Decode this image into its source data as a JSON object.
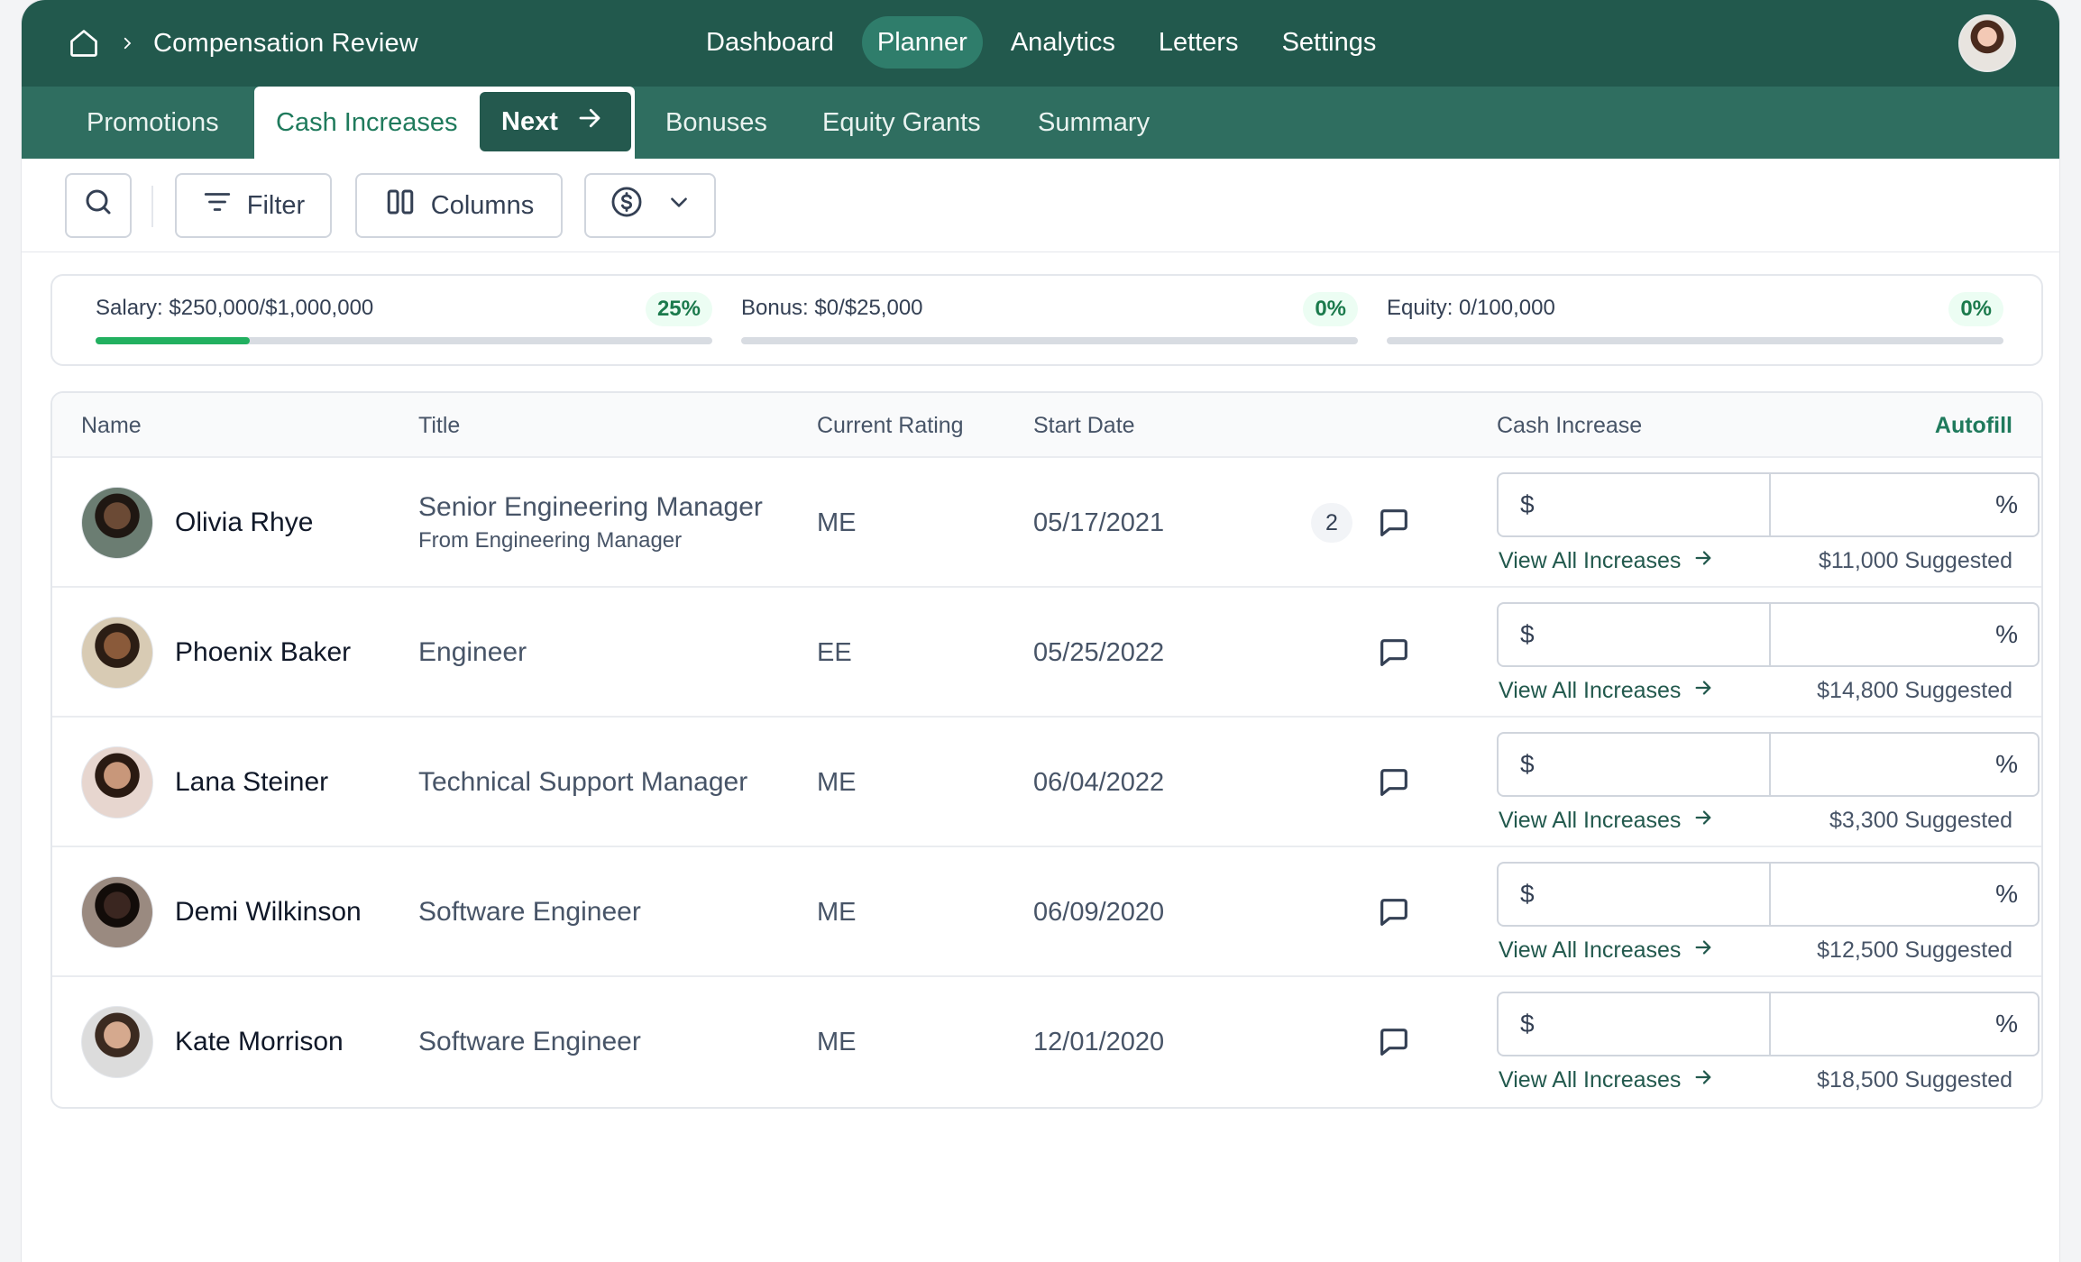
{
  "breadcrumb": {
    "title": "Compensation Review"
  },
  "nav": {
    "items": [
      {
        "label": "Dashboard",
        "active": false
      },
      {
        "label": "Planner",
        "active": true
      },
      {
        "label": "Analytics",
        "active": false
      },
      {
        "label": "Letters",
        "active": false
      },
      {
        "label": "Settings",
        "active": false
      }
    ]
  },
  "subtabs": {
    "promotions": "Promotions",
    "cash_increases": "Cash Increases",
    "next": "Next",
    "bonuses": "Bonuses",
    "equity": "Equity Grants",
    "summary": "Summary"
  },
  "toolbar": {
    "filter": "Filter",
    "columns": "Columns"
  },
  "budget": [
    {
      "label": "Salary:",
      "value": "$250,000/$1,000,000",
      "percent": "25%",
      "progress": 0.25
    },
    {
      "label": "Bonus:",
      "value": "$0/$25,000",
      "percent": "0%",
      "progress": 0
    },
    {
      "label": "Equity:",
      "value": "0/100,000",
      "percent": "0%",
      "progress": 0
    }
  ],
  "table": {
    "headers": {
      "name": "Name",
      "title": "Title",
      "rating": "Current Rating",
      "start": "Start Date",
      "cash": "Cash Increase",
      "autofill": "Autofill"
    },
    "dollar_symbol": "$",
    "percent_symbol": "%",
    "view_all": "View All Increases",
    "rows": [
      {
        "name": "Olivia Rhye",
        "title": "Senior Engineering Manager",
        "subtitle": "From Engineering Manager",
        "rating": "ME",
        "start": "05/17/2021",
        "comments": "2",
        "suggested": "$11,000 Suggested"
      },
      {
        "name": "Phoenix Baker",
        "title": "Engineer",
        "subtitle": "",
        "rating": "EE",
        "start": "05/25/2022",
        "comments": "",
        "suggested": "$14,800 Suggested"
      },
      {
        "name": "Lana Steiner",
        "title": "Technical Support Manager",
        "subtitle": "",
        "rating": "ME",
        "start": "06/04/2022",
        "comments": "",
        "suggested": "$3,300 Suggested"
      },
      {
        "name": "Demi Wilkinson",
        "title": "Software Engineer",
        "subtitle": "",
        "rating": "ME",
        "start": "06/09/2020",
        "comments": "",
        "suggested": "$12,500 Suggested"
      },
      {
        "name": "Kate Morrison",
        "title": "Software Engineer",
        "subtitle": "",
        "rating": "ME",
        "start": "12/01/2020",
        "comments": "",
        "suggested": "$18,500 Suggested"
      }
    ]
  }
}
